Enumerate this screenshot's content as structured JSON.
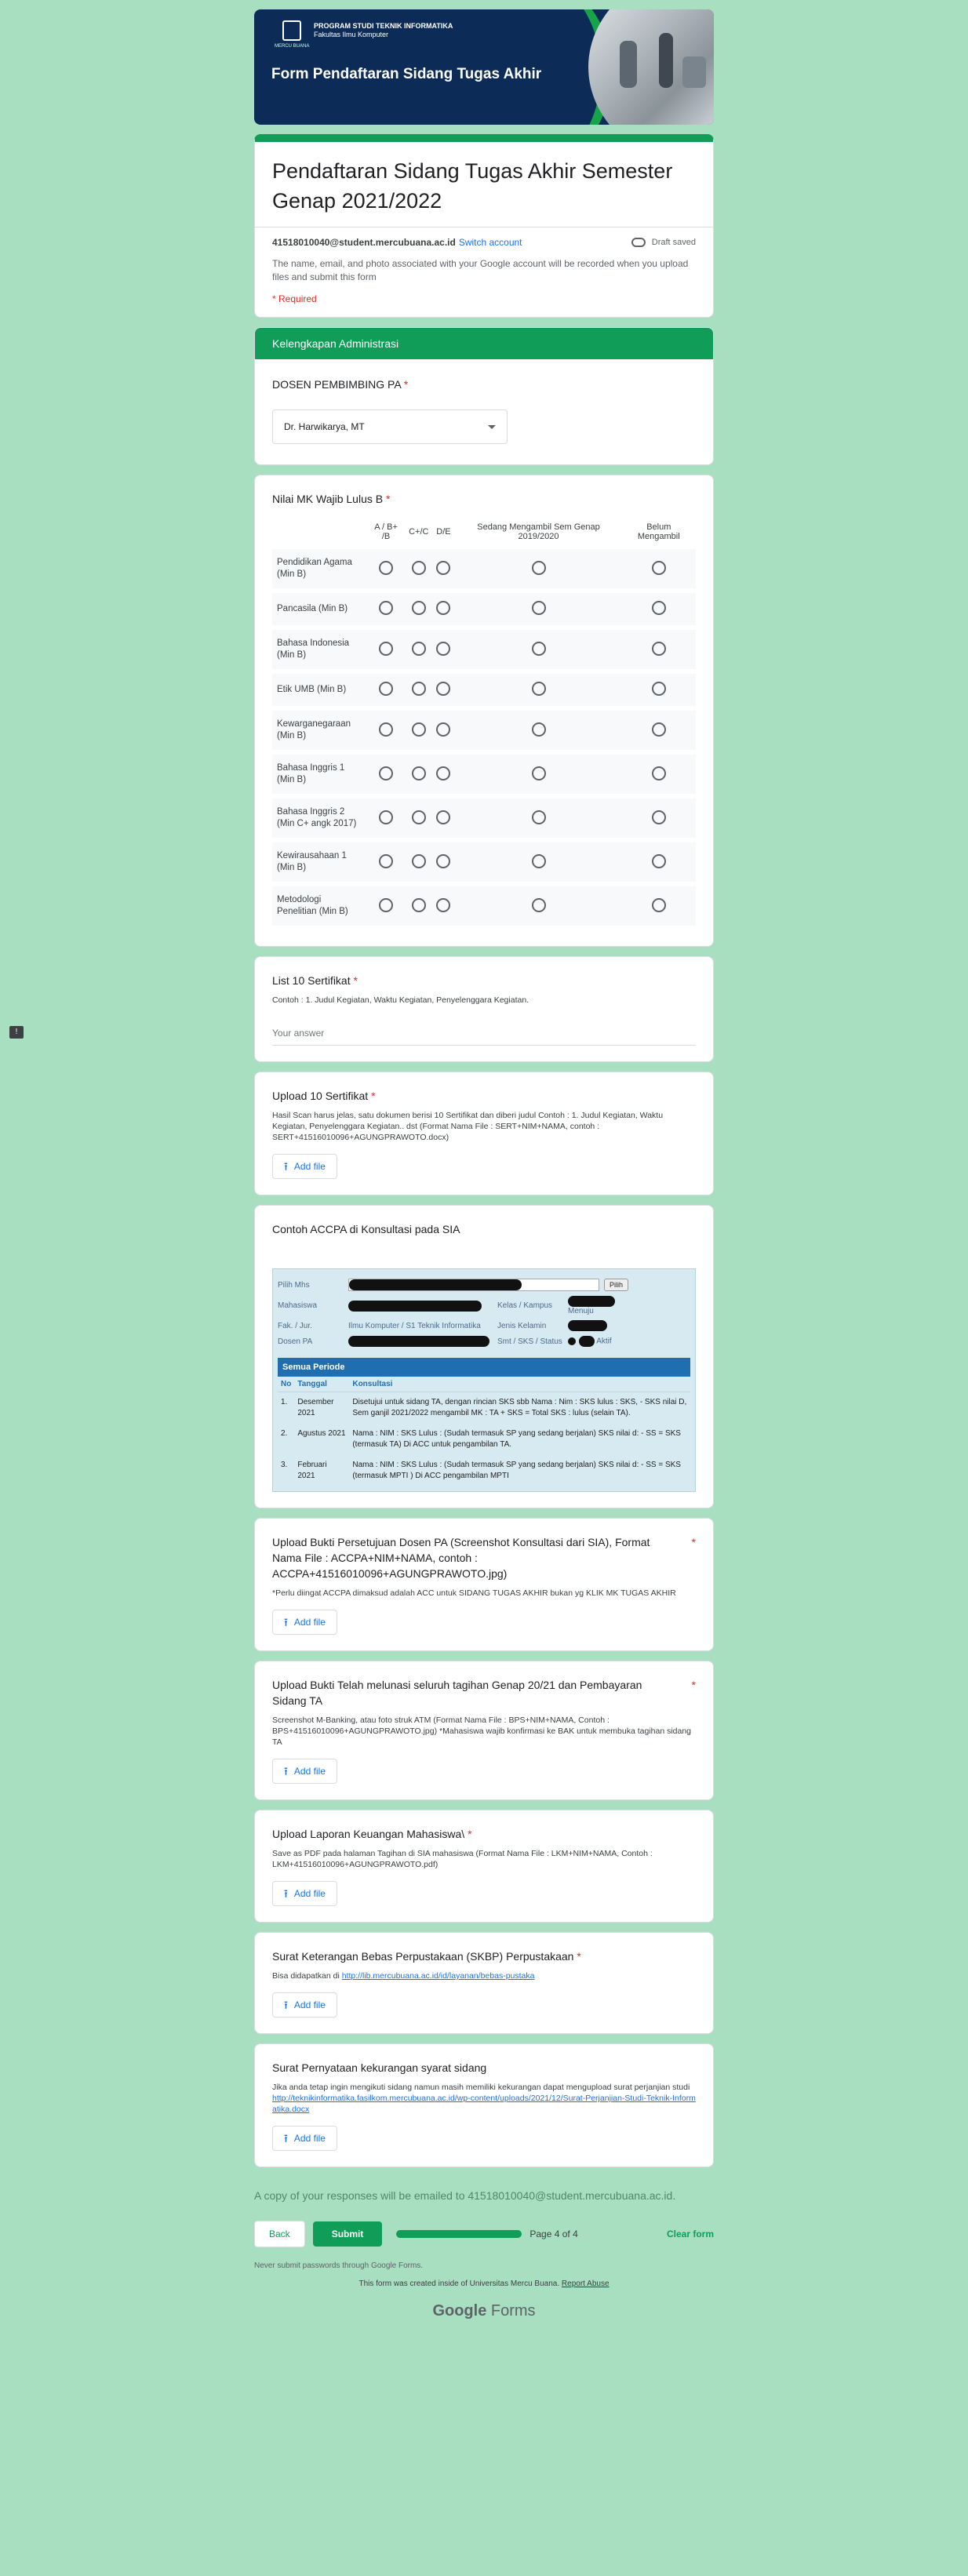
{
  "banner": {
    "program_line1": "PROGRAM STUDI TEKNIK INFORMATIKA",
    "program_line2": "Fakultas Ilmu Komputer",
    "logo_text": "MERCU BUANA",
    "title": "Form Pendaftaran Sidang Tugas Akhir"
  },
  "form": {
    "title": "Pendaftaran Sidang Tugas Akhir Semester Genap 2021/2022",
    "email": "41518010040@student.mercubuana.ac.id",
    "switch_account": "Switch account",
    "draft_status": "Draft saved",
    "privacy_note": "The name, email, and photo associated with your Google account will be recorded when you upload files and submit this form",
    "required_note": "* Required"
  },
  "section": {
    "header": "Kelengkapan Administrasi"
  },
  "q_dosen": {
    "title": "DOSEN PEMBIMBING PA",
    "selected": "Dr. Harwikarya, MT"
  },
  "q_nilai": {
    "title": "Nilai MK Wajib Lulus B",
    "columns": [
      "A / B+ /B",
      "C+/C",
      "D/E",
      "Sedang Mengambil Sem Genap 2019/2020",
      "Belum Mengambil"
    ],
    "rows": [
      "Pendidikan Agama (Min B)",
      "Pancasila (Min B)",
      "Bahasa Indonesia (Min B)",
      "Etik UMB (Min B)",
      "Kewarganegaraan (Min B)",
      "Bahasa Inggris 1 (Min B)",
      "Bahasa Inggris 2 (Min C+ angk 2017)",
      "Kewirausahaan 1 (Min B)",
      "Metodologi Penelitian (Min B)"
    ]
  },
  "q_list10": {
    "title": "List 10 Sertifikat",
    "hint": "Contoh : 1. Judul Kegiatan, Waktu Kegiatan, Penyelenggara Kegiatan.",
    "placeholder": "Your answer"
  },
  "q_upload10": {
    "title": "Upload 10 Sertifikat",
    "hint": "Hasil Scan harus jelas, satu dokumen berisi 10 Sertifikat dan diberi judul Contoh : 1. Judul Kegiatan, Waktu Kegiatan, Penyelenggara Kegiatan.. dst (Format Nama File : SERT+NIM+NAMA, contoh : SERT+41516010096+AGUNGPRAWOTO.docx)",
    "add_file": "Add file"
  },
  "q_accpa": {
    "title": "Contoh ACCPA di Konsultasi pada SIA",
    "sia": {
      "pilih_mhs": "Pilih Mhs",
      "pilih_btn": "Pilih",
      "mahasiswa": "Mahasiswa",
      "kelas": "Kelas / Kampus",
      "kampus_val": "Menuju",
      "fak": "Fak. / Jur.",
      "fak_val": "Ilmu Komputer / S1 Teknik Informatika",
      "jenis": "Jenis Kelamin",
      "dosen": "Dosen PA",
      "smt": "Smt / SKS / Status",
      "status_val": "Aktif",
      "periode": "Semua Periode",
      "col_no": "No",
      "col_tanggal": "Tanggal",
      "col_konsultasi": "Konsultasi",
      "entries": [
        {
          "no": "1.",
          "tanggal": "Desember 2021",
          "text": "Disetujui untuk sidang TA, dengan rincian SKS sbb Nama : Nim : SKS lulus : SKS, - SKS nilai D, Sem ganjil 2021/2022 mengambil MK : TA + SKS = Total SKS : lulus (selain TA)."
        },
        {
          "no": "2.",
          "tanggal": "Agustus 2021",
          "text": "Nama : NIM : SKS Lulus : (Sudah termasuk SP yang sedang berjalan) SKS nilai d: - SS = SKS (termasuk TA) Di ACC untuk pengambilan TA."
        },
        {
          "no": "3.",
          "tanggal": "Februari 2021",
          "text": "Nama : NIM : SKS Lulus : (Sudah termasuk SP yang sedang berjalan) SKS nilai d: - SS = SKS (termasuk MPTI ) Di ACC pengambilan MPTI"
        }
      ]
    }
  },
  "q_buktipa": {
    "title": "Upload Bukti Persetujuan Dosen PA (Screenshot Konsultasi dari SIA), Format Nama File : ACCPA+NIM+NAMA, contoh : ACCPA+41516010096+AGUNGPRAWOTO.jpg)",
    "hint": "*Perlu diingat ACCPA dimaksud adalah ACC untuk SIDANG TUGAS AKHIR bukan yg KLIK MK TUGAS AKHIR",
    "add_file": "Add file"
  },
  "q_lunas": {
    "title": "Upload Bukti Telah melunasi seluruh tagihan Genap 20/21 dan Pembayaran Sidang TA",
    "hint": "Screenshot M-Banking, atau foto struk ATM (Format Nama File : BPS+NIM+NAMA, Contoh : BPS+41516010096+AGUNGPRAWOTO.jpg) *Mahasiswa wajib konfirmasi ke BAK untuk membuka tagihan sidang TA",
    "add_file": "Add file"
  },
  "q_keuangan": {
    "title": "Upload Laporan Keuangan Mahasiswa\\",
    "hint": "Save as PDF pada halaman Tagihan di SIA mahasiswa (Format Nama File : LKM+NIM+NAMA, Contoh : LKM+41516010096+AGUNGPRAWOTO.pdf)",
    "add_file": "Add file"
  },
  "q_skbp": {
    "title": "Surat Keterangan Bebas Perpustakaan (SKBP) Perpustakaan",
    "hint_prefix": "Bisa didapatkan di ",
    "link": "http://lib.mercubuana.ac.id/id/layanan/bebas-pustaka",
    "add_file": "Add file"
  },
  "q_pernyataan": {
    "title": "Surat Pernyataan kekurangan syarat sidang",
    "hint_prefix": "Jika anda tetap ingin mengikuti sidang namun masih memiliki kekurangan dapat mengupload surat perjanjian studi ",
    "link": "http://teknikinformatika.fasilkom.mercubuana.ac.id/wp-content/uploads/2021/12/Surat-Perjanjian-Studi-Teknik-Informatika.docx",
    "add_file": "Add file"
  },
  "footer": {
    "copy_note": "A copy of your responses will be emailed to 41518010040@student.mercubuana.ac.id.",
    "back": "Back",
    "submit": "Submit",
    "page": "Page 4 of 4",
    "progress": 1.0,
    "clear": "Clear form",
    "never": "Never submit passwords through Google Forms.",
    "created_prefix": "This form was created inside of Universitas Mercu Buana.",
    "report_abuse": "Report Abuse",
    "brand_google": "Google",
    "brand_forms": "Forms"
  },
  "colors": {
    "background": "#a8dfc0",
    "accent": "#0f9d58",
    "required": "#d93025",
    "link": "#1a73e8"
  }
}
